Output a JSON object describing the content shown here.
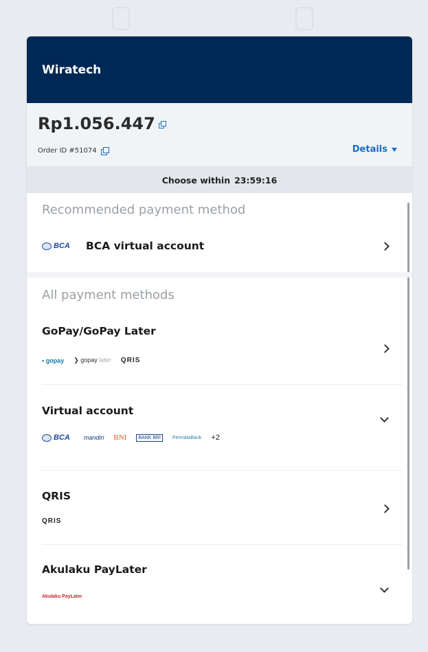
{
  "merchant": "Wiratech",
  "summary": {
    "amount": "Rp1.056.447",
    "order_id": "Order ID #51074",
    "details_label": "Details"
  },
  "timer": {
    "label": "Choose within",
    "time": "23:59:16"
  },
  "recommended": {
    "section_title": "Recommended payment method",
    "item": {
      "logo": "BCA",
      "label": "BCA virtual account"
    }
  },
  "all": {
    "section_title": "All payment methods",
    "methods": [
      {
        "title": "GoPay/GoPay Later",
        "logos": [
          "gopay",
          "gopay",
          "later",
          "QRIS"
        ],
        "chevron": "right"
      },
      {
        "title": "Virtual account",
        "logos": [
          "BCA",
          "mandiri",
          "BNI",
          "BANK BRI",
          "PermataBank",
          "+2"
        ],
        "chevron": "down"
      },
      {
        "title": "QRIS",
        "logos": [
          "QRIS"
        ],
        "chevron": "right"
      },
      {
        "title": "Akulaku PayLater",
        "logos": [
          "Akulaku PayLater"
        ],
        "chevron": "down"
      }
    ]
  },
  "colors": {
    "header_bg": "#002855",
    "accent": "#1a6ec9"
  }
}
